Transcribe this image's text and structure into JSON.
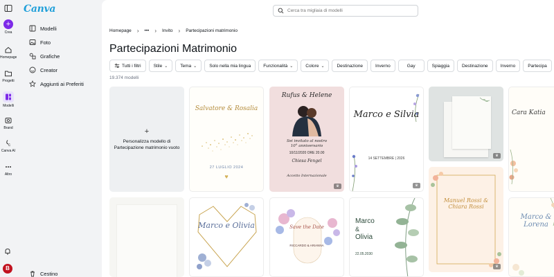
{
  "app": {
    "logo": "Canva"
  },
  "rail": {
    "items": [
      {
        "label": "Crea"
      },
      {
        "label": "Homepage"
      },
      {
        "label": "Progetti"
      },
      {
        "label": "Modelli"
      },
      {
        "label": "Brand"
      },
      {
        "label": "Canva AI"
      },
      {
        "label": "Altro"
      }
    ],
    "avatar_initial": "B"
  },
  "sidebar": {
    "items": [
      {
        "label": "Modelli",
        "icon": "template-icon"
      },
      {
        "label": "Foto",
        "icon": "photo-icon"
      },
      {
        "label": "Grafiche",
        "icon": "shapes-icon"
      },
      {
        "label": "Creator",
        "icon": "creator-icon"
      },
      {
        "label": "Aggiunti ai Preferiti",
        "icon": "star-icon"
      }
    ],
    "trash_label": "Cestino"
  },
  "search": {
    "placeholder": "Cerca tra migliaia di modelli"
  },
  "breadcrumb": {
    "home": "Homepage",
    "more": "•••",
    "parent": "Invito",
    "current": "Partecipazioni matrimonio"
  },
  "page": {
    "title": "Partecipazioni Matrimonio",
    "count": "19.374 modelli"
  },
  "filters": {
    "all_label": "Tutti i filtri",
    "dropdowns": [
      "Stile",
      "Tema"
    ],
    "single_language": "Solo nella mia lingua",
    "dropdowns2": [
      "Funzionalità",
      "Colore"
    ],
    "tags": [
      "Destinazione",
      "Inverno",
      "Gay",
      "Spiaggia",
      "Destinazione",
      "Inverno",
      "Partecipa"
    ]
  },
  "custom_card": {
    "plus": "+",
    "text": "Personalizza modello di Partecipazione matrimonio vuoto"
  },
  "templates": {
    "t1": {
      "names": "Salvatore & Rosalia",
      "date": "27 LUGLIO 2024"
    },
    "t2": {
      "names": "Rufus & Helene",
      "line1": "Sei invitato al nostro",
      "line2": "10° anniversario",
      "date": "10/11/2020 ORE 20.00",
      "venue": "Chiesa Fengel",
      "extra": "Accetto Internazionale"
    },
    "t3": {
      "names": "Marco e Silvia",
      "date": "14 SETTEMBRE | 2026"
    },
    "t5": {
      "names": "Cara Katia"
    },
    "t7": {
      "names": "Marco e Olivia"
    },
    "t8": {
      "line1": "Save the Date",
      "names": "RICCARDO & ARIANNA"
    },
    "t9": {
      "name1": "Marco",
      "amp": "&",
      "name2": "Olivia",
      "date": "22.05.2030"
    },
    "t10": {
      "names": "Manuel Rossi & Chiara Rossi"
    },
    "t11": {
      "names": "Marco & Lorena"
    }
  },
  "colors": {
    "brand_purple": "#7d2ae8",
    "canva_blue": "#1f9fd9",
    "avatar_red": "#c1121f"
  }
}
